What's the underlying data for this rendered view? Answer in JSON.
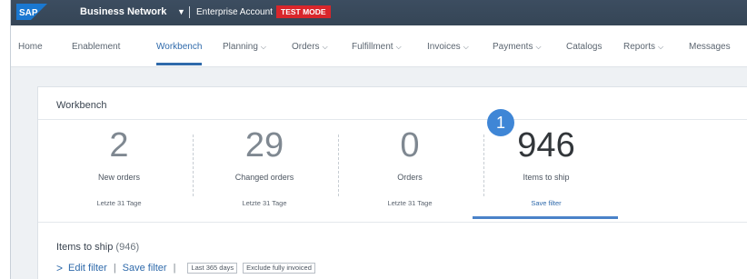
{
  "shell": {
    "logo_text": "SAP",
    "app_title": "Business Network",
    "account": "Enterprise Account",
    "mode_badge": "TEST MODE",
    "brand_color": "#1a78d1"
  },
  "nav": {
    "items": [
      {
        "label": "Home"
      },
      {
        "label": "Enablement"
      },
      {
        "label": "Workbench"
      },
      {
        "label": "Planning"
      },
      {
        "label": "Orders"
      },
      {
        "label": "Fulfillment"
      },
      {
        "label": "Invoices"
      },
      {
        "label": "Payments"
      },
      {
        "label": "Catalogs"
      },
      {
        "label": "Reports"
      },
      {
        "label": "Messages"
      }
    ],
    "active": "Workbench"
  },
  "workbench": {
    "title": "Workbench",
    "tiles": [
      {
        "value": "2",
        "label": "New orders",
        "sub": "Letzte 31 Tage"
      },
      {
        "value": "29",
        "label": "Changed orders",
        "sub": "Letzte 31 Tage"
      },
      {
        "value": "0",
        "label": "Orders",
        "sub": "Letzte 31 Tage"
      },
      {
        "value": "946",
        "label": "Items to ship",
        "sub": "Save filter"
      }
    ],
    "callout_number": "1"
  },
  "section": {
    "title": "Items to ship",
    "count": "(946)",
    "edit_filter": "Edit filter",
    "save_filter": "Save filter",
    "chips": [
      "Last 365 days",
      "Exclude fully invoiced"
    ]
  }
}
